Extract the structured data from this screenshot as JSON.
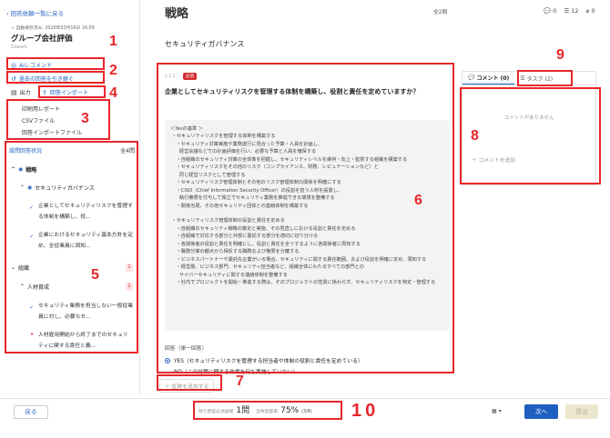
{
  "sidebar": {
    "back_link": "回答依頼一覧に戻る",
    "autosave": "自動保存済み: 2026年03月16日 16:09",
    "title": "グループ会社評価",
    "company": "Cowork",
    "ai_recommend": "AIレコメンド",
    "carry_over": "過去の回答を引き継ぐ",
    "output": "出力",
    "answer_import": "回答インポート",
    "menu": [
      "印刷用レポート",
      "CSVファイル",
      "回答インポートファイル"
    ],
    "status_label": "設問回答状況",
    "status_count": "全4問",
    "tree": {
      "strategy": "戦略",
      "security_gov": "セキュリティガバナンス",
      "q1": "企業としてセキュリティリスクを管理する体制を構築し、役...",
      "q2": "企業におけるセキュリティ基本方針を定め、全従業員に周知...",
      "org": "組織",
      "org_badge": "1",
      "hr": "人材育成",
      "hr_badge": "1",
      "q3": "セキュリティ業務を担当しない一般従業員に対し、必要なセ...",
      "q4": "人材雇用開始から終了までのセキュリティに関する責任と義..."
    }
  },
  "header": {
    "title": "戦略",
    "total": "全2問",
    "comments_count": "0",
    "tasks_count": "12",
    "attachments_count": "0"
  },
  "section_title": "セキュリティガバナンス",
  "question": {
    "number": "1.1.1",
    "required": "必須",
    "title": "企業としてセキュリティリスクを管理する体制を構築し、役割と責任を定めていますか？",
    "criteria": "＜Yesの基準 ＞\n ・セキュリティリスクを管理する体制を構築する\n    ・セキュリティ対策実施や業務遂行に見合った予算・人員を計画し、\n      経営会議などでの計画評価を行い、必要な予算と人員を確保する\n    ・自組織のセキュリティ対策の全体像を把握し、セキュリティレベルを維持・向上・監督する組織を構築する\n    ・セキュリティリスクをその他のリスク（コンプライアンス、財務、レピュテーションなど）と\n      同じ経営リスクとして管理する\n    ・セキュリティリスク管理体制とその他のリスク管理体制の関係を明確にする\n    ・CISO（Chief Information Security Officer）の役割を担う人材を設置し、\n      執行権限を付与して独立でセキュリティ業務を推進できる環境を整備する\n    ・関係当局、その他セキュリティ団体との連絡体制を構築する\n\n ・セキュリティリスク管理体制の役割と責任を定める\n    ・自組織のセキュリティ戦略の策定と実施、その見直しにおける役割と責任を定める\n    ・自組織で対応する部分と外部に委託する部分を適切に切り分ける\n    ・各関係者の役割と責任を明確にし、役割と責任を全うするように各関係者に周知する\n    ・職務分掌の観点から相反する職務および権限を分離する\n    ・ビジネスパートナーや委託先企業がいる場合、セキュリティに関する責任範囲、および役割を明確に定め、周知する\n    ・経営層、ビジネス部門、セキュリティ担当者など、組織全体にわたるすべての部門との\n      サイバーセキュリティに関する連絡体制を整備する\n    ・社内でプロジェクトを開始・推進する際は、そのプロジェクトの性質に係わらず、セキュリティリスクを特定・管理する",
    "answer_label": "回答（単一回答）",
    "options": [
      "YES（セキュリティリスクを管理する担当者や体制の役割と責任を定めている）",
      "NO（この対策に関する作業を何も実施していない）"
    ],
    "add_evidence": "証跡を追加する"
  },
  "right_panel": {
    "comment_tab": "コメント (0)",
    "task_tab": "タスク (2)",
    "no_comment": "コメントがありません",
    "add_comment": "コメントを追加"
  },
  "footer": {
    "back": "戻る",
    "remaining_label": "残り回答必須設問",
    "remaining_value": "1問",
    "rate_label": "全体回答率",
    "rate_value": "75%",
    "rate_detail": "(3/4)",
    "next": "次へ",
    "submit": "提出"
  },
  "annotations": [
    "1",
    "2",
    "3",
    "4",
    "5",
    "6",
    "7",
    "8",
    "9",
    "10"
  ],
  "colors": {
    "accent": "#1f5fbf",
    "annotation": "#e8262a",
    "required": "#d32f2f"
  }
}
